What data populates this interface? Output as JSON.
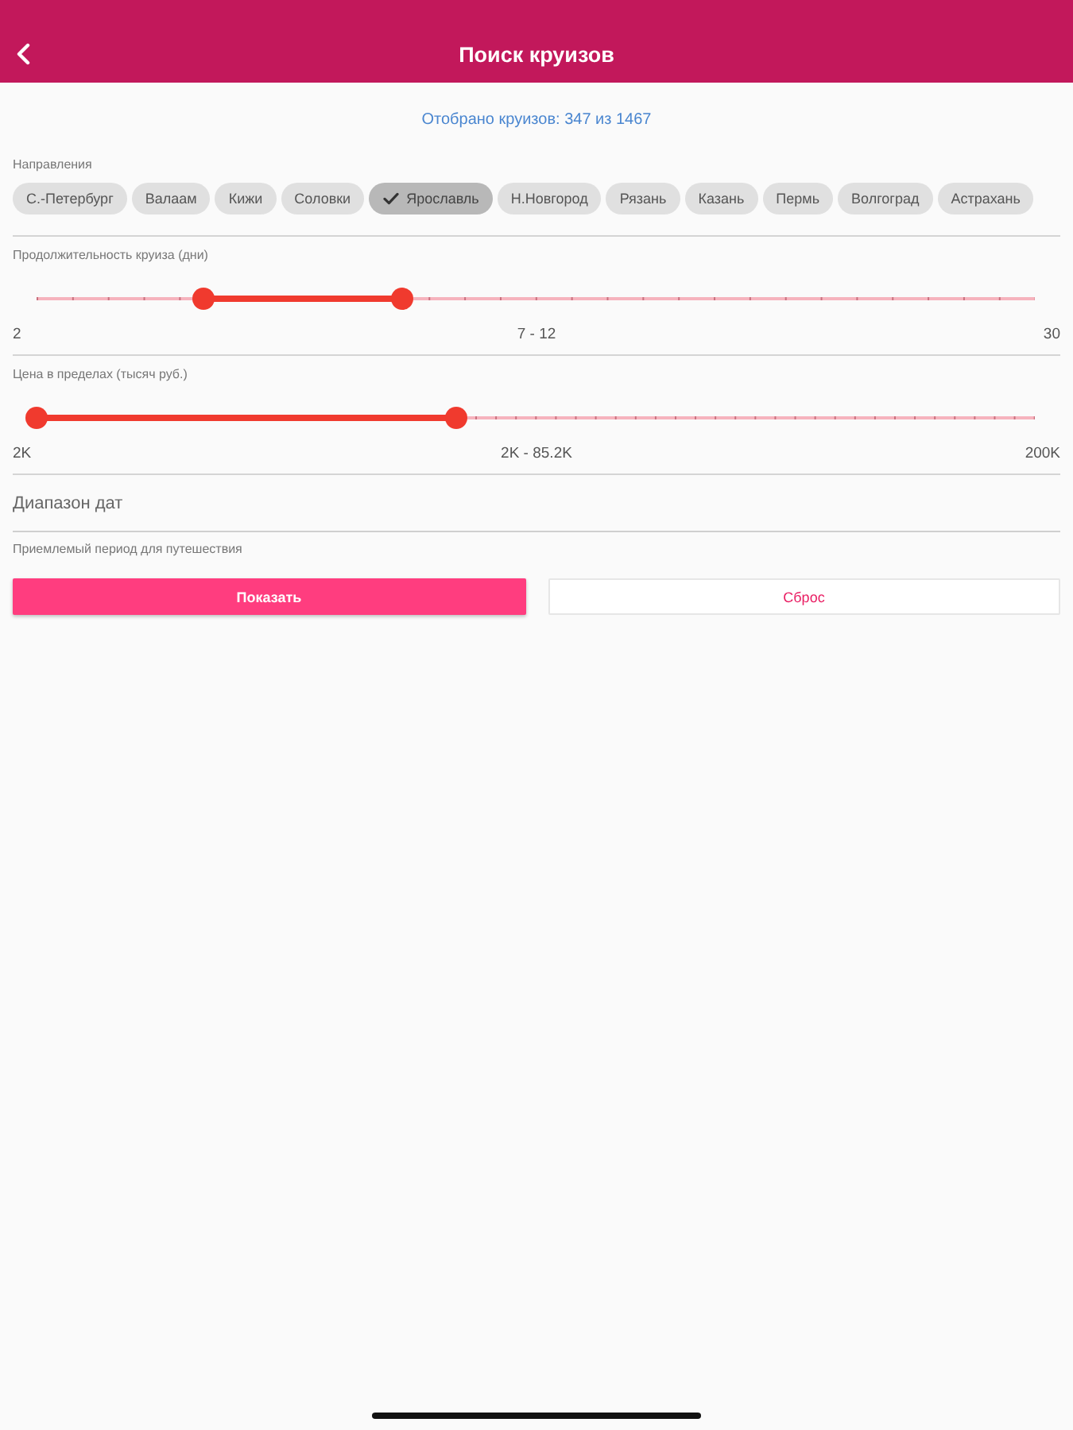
{
  "header": {
    "title": "Поиск круизов"
  },
  "summary": "Отобрано круизов: 347 из 1467",
  "directions": {
    "label": "Направления",
    "chips": [
      {
        "label": "С.-Петербург",
        "selected": false
      },
      {
        "label": "Валаам",
        "selected": false
      },
      {
        "label": "Кижи",
        "selected": false
      },
      {
        "label": "Соловки",
        "selected": false
      },
      {
        "label": "Ярославль",
        "selected": true
      },
      {
        "label": "Н.Новгород",
        "selected": false
      },
      {
        "label": "Рязань",
        "selected": false
      },
      {
        "label": "Казань",
        "selected": false
      },
      {
        "label": "Пермь",
        "selected": false
      },
      {
        "label": "Волгоград",
        "selected": false
      },
      {
        "label": "Астрахань",
        "selected": false
      }
    ]
  },
  "sliders": [
    {
      "label": "Продолжительность круиза (дни)",
      "thumbs": [
        {
          "level": 0.167
        },
        {
          "level": 0.367
        }
      ],
      "min_label": "2",
      "range_label": "7 - 12",
      "max_label": "30"
    },
    {
      "label": "Цена в пределах (тысяч руб.)",
      "thumbs": [
        {
          "level": 0
        },
        {
          "level": 0.42
        }
      ],
      "min_label": "2K",
      "range_label": "2K - 85.2K",
      "max_label": "200K"
    }
  ],
  "date_field": {
    "placeholder": "Диапазон дат",
    "helper": "Приемлемый период для путешествия"
  },
  "buttons": [
    {
      "label": "Показать",
      "kind": "primary"
    },
    {
      "label": "Сброс",
      "kind": "secondary"
    }
  ]
}
